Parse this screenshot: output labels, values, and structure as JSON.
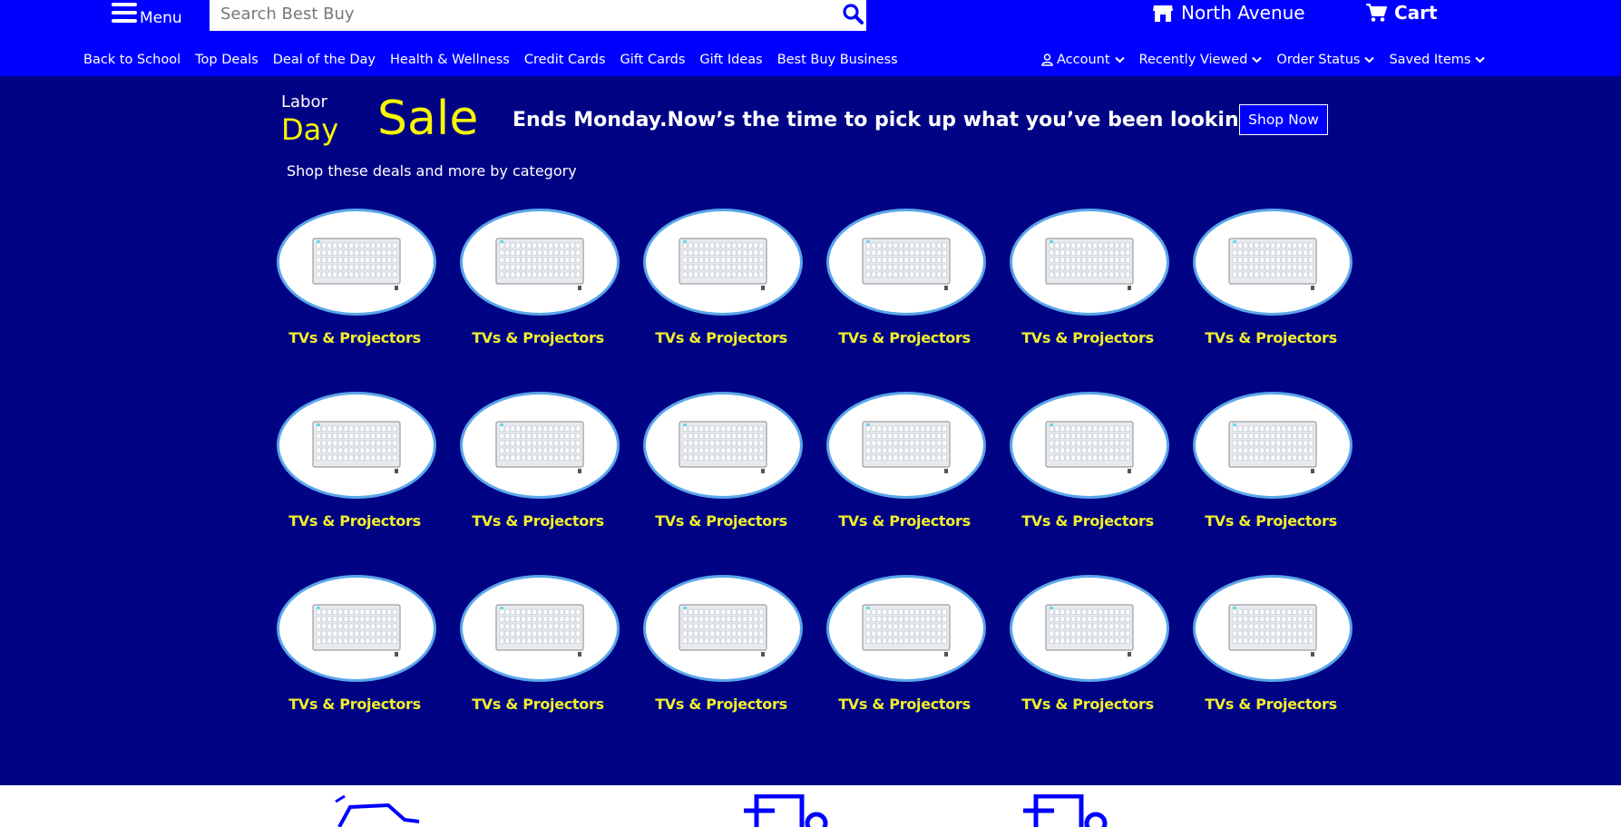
{
  "header": {
    "menu_label": "Menu",
    "search_placeholder": "Search Best Buy",
    "store_name": "North Avenue",
    "cart_label": "Cart"
  },
  "nav": {
    "links": [
      "Back to School",
      "Top Deals",
      "Deal of the Day",
      "Health & Wellness",
      "Credit Cards",
      "Gift Cards",
      "Gift Ideas",
      "Best Buy Business"
    ],
    "right": [
      "Account",
      "Recently Viewed",
      "Order Status",
      "Saved Items"
    ]
  },
  "banner": {
    "labor": "Labor",
    "day": "Day",
    "sale": "Sale",
    "message": "Ends Monday.Now’s the time to pick up what you’ve been looking for.",
    "cta": "Shop Now",
    "subtext": "Shop these deals and more by category"
  },
  "categories": [
    "TVs & Projectors",
    "TVs & Projectors",
    "TVs & Projectors",
    "TVs & Projectors",
    "TVs & Projectors",
    "TVs & Projectors",
    "TVs & Projectors",
    "TVs & Projectors",
    "TVs & Projectors",
    "TVs & Projectors",
    "TVs & Projectors",
    "TVs & Projectors",
    "TVs & Projectors",
    "TVs & Projectors",
    "TVs & Projectors",
    "TVs & Projectors",
    "TVs & Projectors",
    "TVs & Projectors"
  ],
  "colors": {
    "header_bg": "#0000ff",
    "main_bg": "#000484",
    "accent_yellow": "#f7f700",
    "tile_border": "#5aa6ea"
  },
  "icons": [
    "hamburger-icon",
    "search-icon",
    "store-icon",
    "cart-icon",
    "user-icon",
    "chevron-down-icon",
    "keyboard-image",
    "car-icon",
    "calendar-icon"
  ]
}
